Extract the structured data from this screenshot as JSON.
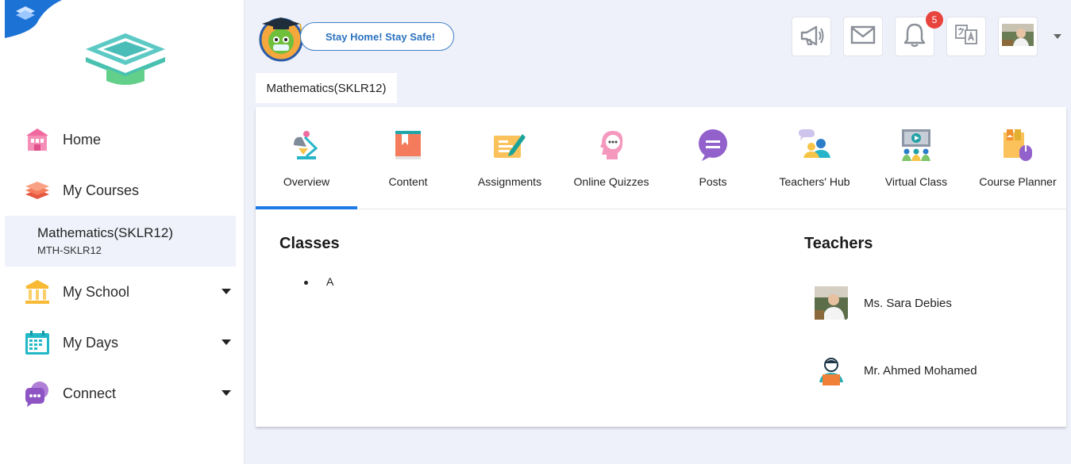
{
  "sidebar": {
    "items": [
      {
        "label": "Home",
        "icon": "home-icon"
      },
      {
        "label": "My Courses",
        "icon": "books-icon"
      },
      {
        "label": "My School",
        "icon": "school-icon"
      },
      {
        "label": "My Days",
        "icon": "calendar-icon"
      },
      {
        "label": "Connect",
        "icon": "chat-icon"
      }
    ],
    "active_course": {
      "title": "Mathematics(SKLR12)",
      "code": "MTH-SKLR12"
    }
  },
  "header": {
    "banner_text": "Stay Home! Stay Safe!",
    "notification_count": "5",
    "icons": [
      "megaphone-icon",
      "mail-icon",
      "bell-icon",
      "translate-icon",
      "profile-avatar"
    ]
  },
  "breadcrumb": {
    "course": "Mathematics(SKLR12)"
  },
  "tabs": [
    {
      "label": "Overview",
      "active": true
    },
    {
      "label": "Content"
    },
    {
      "label": "Assignments"
    },
    {
      "label": "Online Quizzes"
    },
    {
      "label": "Posts"
    },
    {
      "label": "Teachers' Hub"
    },
    {
      "label": "Virtual Class"
    },
    {
      "label": "Course Planner"
    }
  ],
  "overview": {
    "classes_title": "Classes",
    "classes": [
      "A"
    ],
    "teachers_title": "Teachers",
    "teachers": [
      {
        "name": "Ms. Sara Debies"
      },
      {
        "name": "Mr. Ahmed Mohamed"
      }
    ]
  },
  "colors": {
    "accent": "#1e7ae6",
    "badge": "#e8433d",
    "banner": "#2d73c0"
  }
}
